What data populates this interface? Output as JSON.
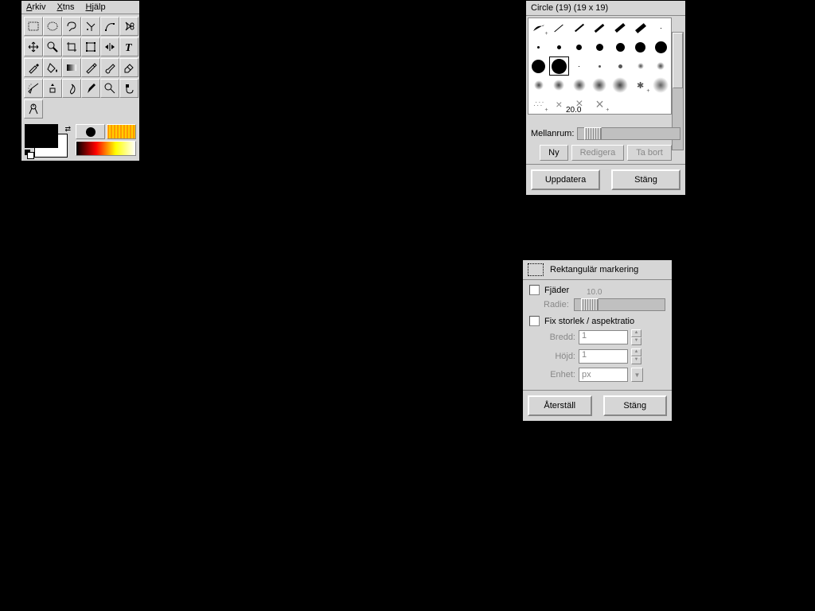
{
  "toolbox": {
    "menu": {
      "arkiv": "Arkiv",
      "xtns": "Xtns",
      "hjalp": "Hjälp"
    }
  },
  "brushes": {
    "header": "Circle (19)  (19 x 19)",
    "spacing_label": "Mellanrum:",
    "spacing_value": "20.0",
    "btn_new": "Ny",
    "btn_edit": "Redigera",
    "btn_delete": "Ta bort",
    "btn_refresh": "Uppdatera",
    "btn_close": "Stäng"
  },
  "options": {
    "title": "Rektangulär markering",
    "feather": "Fjäder",
    "radius_label": "Radie:",
    "radius_value": "10.0",
    "fixed": "Fix storlek / aspektratio",
    "width_label": "Bredd:",
    "width_value": "1",
    "height_label": "Höjd:",
    "height_value": "1",
    "unit_label": "Enhet:",
    "unit_value": "px",
    "btn_reset": "Återställ",
    "btn_close": "Stäng"
  }
}
